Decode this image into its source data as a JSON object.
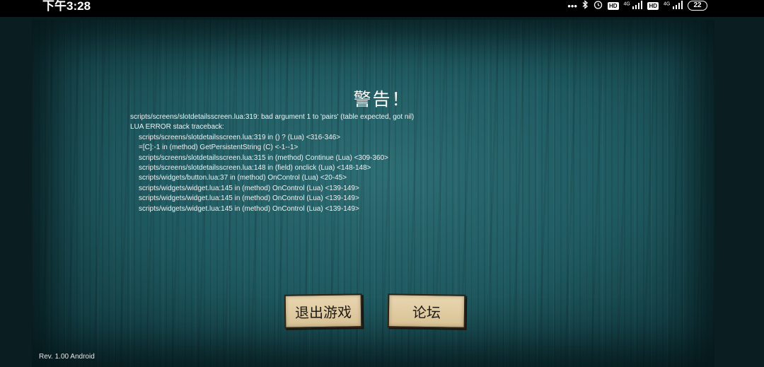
{
  "status_bar": {
    "time": "下午3:28",
    "icons": [
      "more-dots-icon",
      "bluetooth-icon",
      "alarm-icon",
      "hd-volte-icon",
      "4g-signal-icon",
      "hd-volte-icon",
      "4g-signal-icon",
      "battery-icon"
    ],
    "dots": "•••",
    "hd": "HD",
    "net": "4G",
    "battery": "22"
  },
  "dialog": {
    "title": "警告！",
    "error_lines": [
      "scripts/screens/slotdetailsscreen.lua:319: bad argument 1 to 'pairs' (table expected, got nil)",
      "LUA ERROR stack traceback:",
      "scripts/screens/slotdetailsscreen.lua:319 in () ? (Lua) <316-346>",
      "=[C]:-1 in (method) GetPersistentString (C) <-1--1>",
      "scripts/screens/slotdetailsscreen.lua:315 in (method) Continue (Lua) <309-360>",
      "scripts/screens/slotdetailsscreen.lua:148 in (field) onclick (Lua) <148-148>",
      "scripts/widgets/button.lua:37 in (method) OnControl (Lua) <20-45>",
      "scripts/widgets/widget.lua:145 in (method) OnControl (Lua) <139-149>",
      "scripts/widgets/widget.lua:145 in (method) OnControl (Lua) <139-149>",
      "scripts/widgets/widget.lua:145 in (method) OnControl (Lua) <139-149>"
    ],
    "buttons": {
      "quit": "退出游戏",
      "forum": "论坛"
    }
  },
  "footer": {
    "version": "Rev. 1.00 Android"
  },
  "colors": {
    "background_teal": "#1f5a61",
    "button_parchment": "#e2cfa5",
    "text": "#ffffff"
  }
}
